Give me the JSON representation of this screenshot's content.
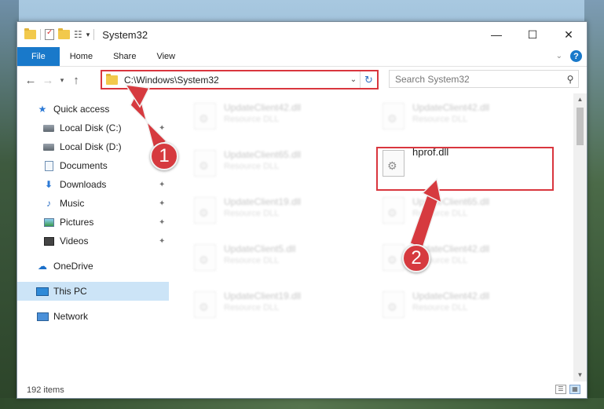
{
  "window": {
    "title": "System32",
    "controls": {
      "minimize": "—",
      "maximize": "☐",
      "close": "✕"
    }
  },
  "ribbon": {
    "tabs": [
      "File",
      "Home",
      "Share",
      "View"
    ],
    "collapse_icon": "chevron-down-icon",
    "help": "?"
  },
  "address": {
    "path": "C:\\Windows\\System32",
    "search_placeholder": "Search System32"
  },
  "sidebar": {
    "items": [
      {
        "label": "Quick access",
        "icon": "star-icon",
        "pinned": false
      },
      {
        "label": "Local Disk (C:)",
        "icon": "disk-icon",
        "pinned": true
      },
      {
        "label": "Local Disk (D:)",
        "icon": "disk-icon",
        "pinned": false
      },
      {
        "label": "Documents",
        "icon": "documents-icon",
        "pinned": false
      },
      {
        "label": "Downloads",
        "icon": "downloads-icon",
        "pinned": true
      },
      {
        "label": "Music",
        "icon": "music-icon",
        "pinned": true
      },
      {
        "label": "Pictures",
        "icon": "pictures-icon",
        "pinned": true
      },
      {
        "label": "Videos",
        "icon": "videos-icon",
        "pinned": true
      },
      {
        "label": "OneDrive",
        "icon": "cloud-icon",
        "pinned": false
      },
      {
        "label": "This PC",
        "icon": "computer-icon",
        "pinned": false,
        "selected": true
      },
      {
        "label": "Network",
        "icon": "network-icon",
        "pinned": false
      }
    ]
  },
  "files": [
    {
      "name": "UpdateClient42.dll",
      "type": "Resource DLL"
    },
    {
      "name": "UpdateClient42.dll",
      "type": "Resource DLL"
    },
    {
      "name": "UpdateClient65.dll",
      "type": "Resource DLL"
    },
    {
      "name": "hprof.dll",
      "type": ""
    },
    {
      "name": "UpdateClient19.dll",
      "type": "Resource DLL"
    },
    {
      "name": "UpdateClient65.dll",
      "type": "Resource DLL"
    },
    {
      "name": "UpdateClient5.dll",
      "type": "Resource DLL"
    },
    {
      "name": "UpdateClient42.dll",
      "type": "Resource DLL"
    },
    {
      "name": "UpdateClient19.dll",
      "type": "Resource DLL"
    },
    {
      "name": "UpdateClient42.dll",
      "type": "Resource DLL"
    }
  ],
  "status": {
    "item_count": "192 items"
  },
  "annotations": {
    "step1": "1",
    "step2": "2",
    "color": "#d63a3f"
  }
}
